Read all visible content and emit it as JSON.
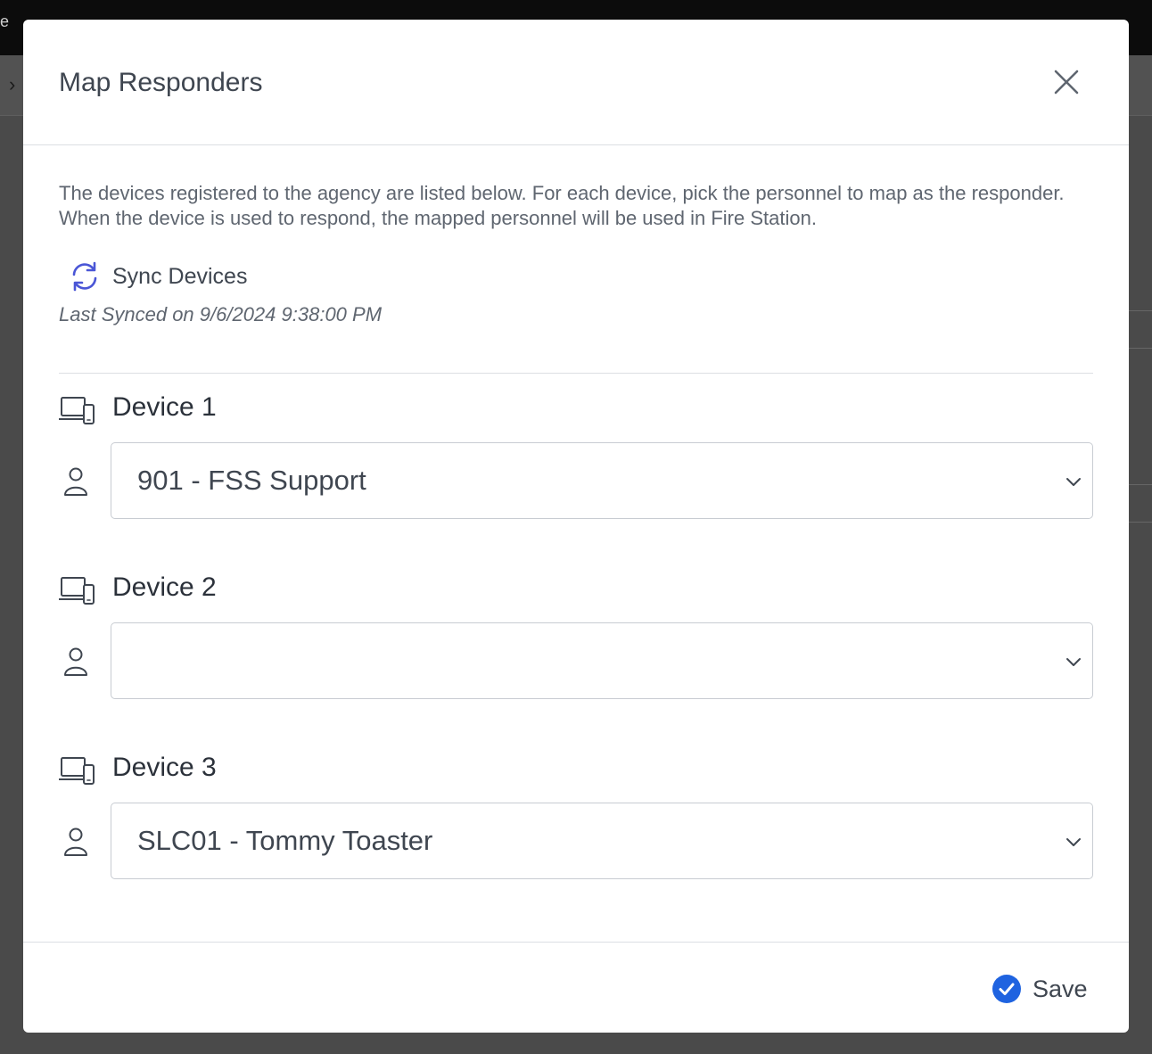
{
  "backdrop": {
    "top_fragment": "e",
    "sub_chevron": "›"
  },
  "modal": {
    "title": "Map Responders",
    "close_icon": "close-icon",
    "description": "The devices registered to the agency are listed below. For each device, pick the personnel to map as the responder. When the device is used to respond, the mapped personnel will be used in Fire Station.",
    "sync": {
      "label": "Sync Devices",
      "icon": "sync-icon",
      "icon_color": "#4a56d6"
    },
    "last_synced": "Last Synced on 9/6/2024 9:38:00 PM",
    "devices": [
      {
        "label": "Device 1",
        "selected_personnel": "901 - FSS Support"
      },
      {
        "label": "Device 2",
        "selected_personnel": ""
      },
      {
        "label": "Device 3",
        "selected_personnel": "SLC01 - Tommy Toaster"
      }
    ],
    "footer": {
      "save_label": "Save",
      "save_icon": "check-circle-icon",
      "save_icon_color": "#1f63e0"
    }
  }
}
